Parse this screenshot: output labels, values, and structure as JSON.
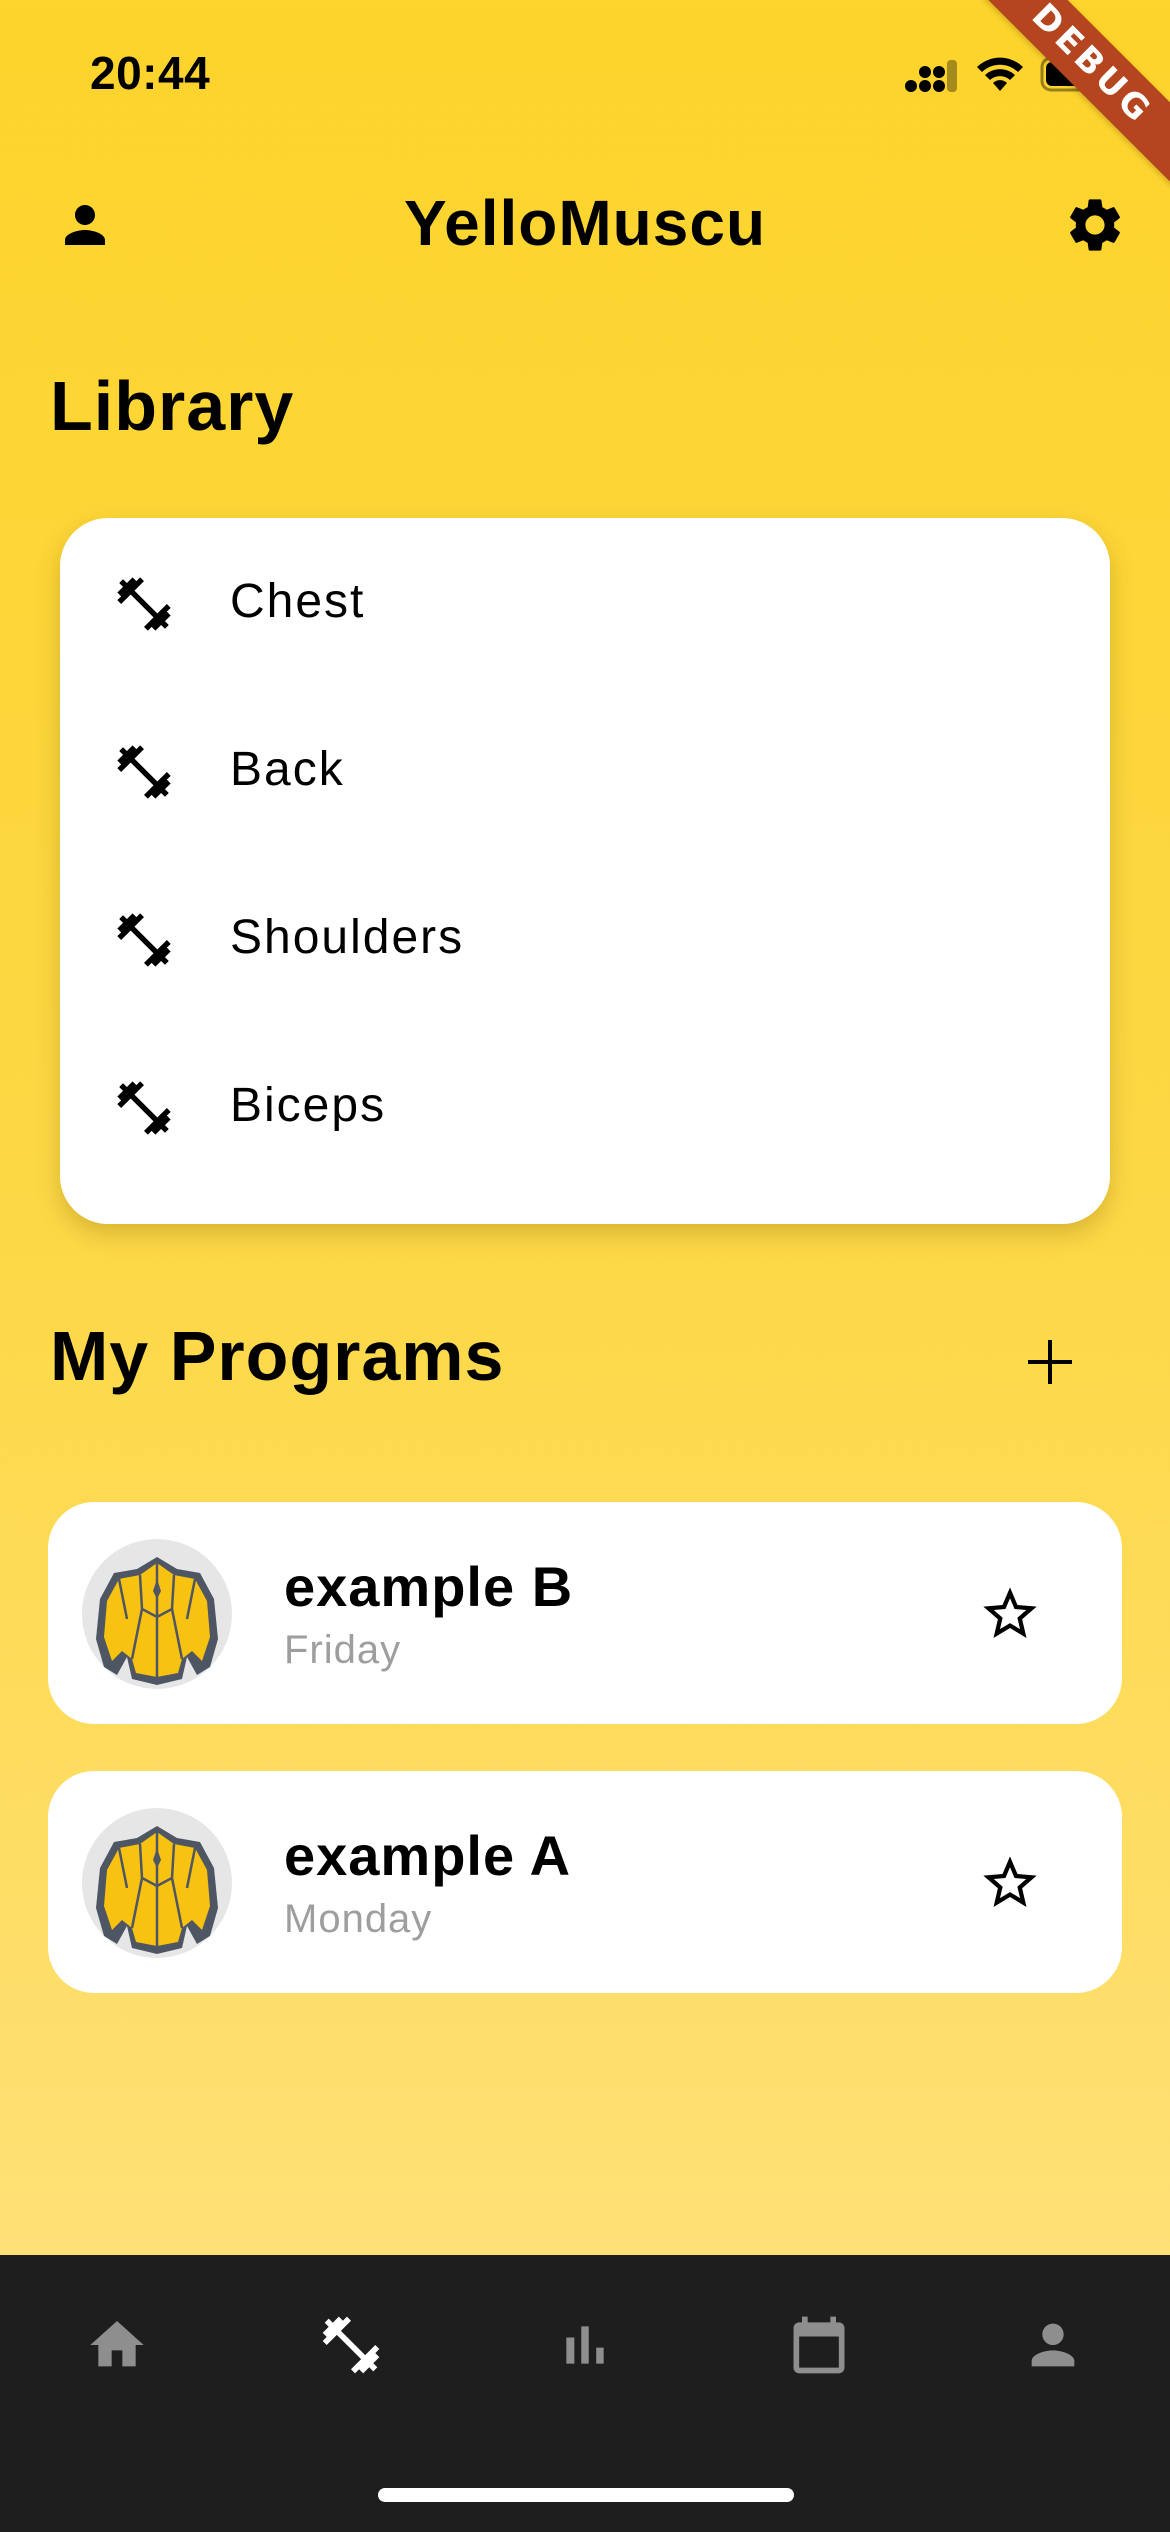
{
  "status_bar": {
    "time": "20:44"
  },
  "debug_banner": "DEBUG",
  "header": {
    "title": "YelloMuscu",
    "left_icon": "person-icon",
    "right_icon": "gear-icon"
  },
  "library": {
    "title": "Library",
    "items": [
      {
        "label": "Chest",
        "icon": "dumbbell-icon"
      },
      {
        "label": "Back",
        "icon": "dumbbell-icon"
      },
      {
        "label": "Shoulders",
        "icon": "dumbbell-icon"
      },
      {
        "label": "Biceps",
        "icon": "dumbbell-icon"
      }
    ]
  },
  "programs": {
    "title": "My Programs",
    "add_icon": "plus-icon",
    "items": [
      {
        "name": "example B",
        "day": "Friday",
        "favorite": false
      },
      {
        "name": "example A",
        "day": "Monday",
        "favorite": false
      }
    ]
  },
  "bottom_nav": {
    "items": [
      "home-icon",
      "dumbbell-icon",
      "bar-chart-icon",
      "calendar-icon",
      "person-icon"
    ],
    "active": "dumbbell-icon",
    "active_color": "#FFFFFF",
    "inactive_color": "#8E8E8E"
  },
  "colors": {
    "background": "#FDD42B",
    "card": "#FFFFFF",
    "nav": "#1E1E1E",
    "banner": "#B4451E"
  }
}
